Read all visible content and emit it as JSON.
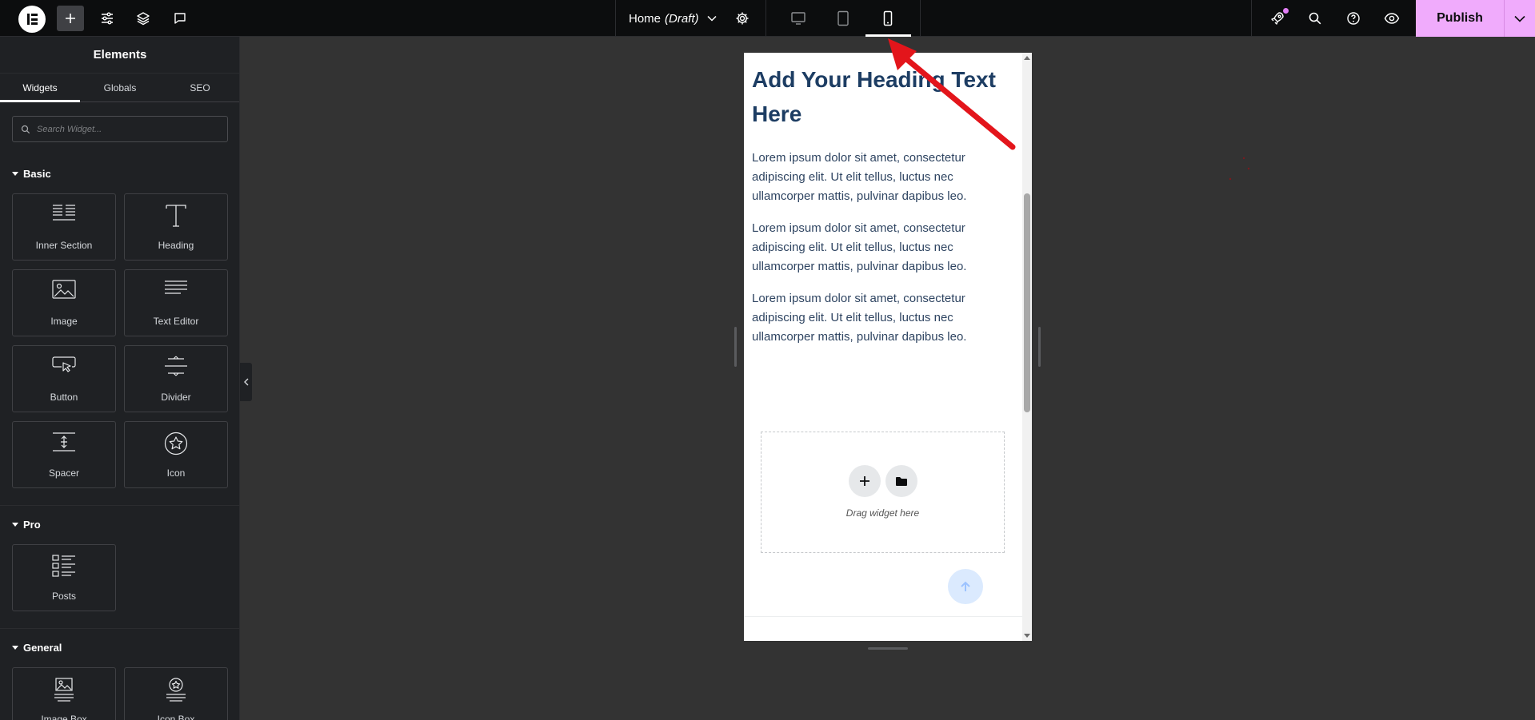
{
  "topbar": {
    "page_name": "Home",
    "page_status": "(Draft)",
    "publish_label": "Publish",
    "accent_color": "#f0abfc"
  },
  "sidebar": {
    "title": "Elements",
    "tabs": [
      {
        "label": "Widgets",
        "active": true
      },
      {
        "label": "Globals",
        "active": false
      },
      {
        "label": "SEO",
        "active": false
      }
    ],
    "search_placeholder": "Search Widget...",
    "categories": [
      {
        "name": "Basic",
        "widgets": [
          {
            "label": "Inner Section",
            "icon": "inner-section-icon"
          },
          {
            "label": "Heading",
            "icon": "heading-icon"
          },
          {
            "label": "Image",
            "icon": "image-icon"
          },
          {
            "label": "Text Editor",
            "icon": "text-editor-icon"
          },
          {
            "label": "Button",
            "icon": "button-icon"
          },
          {
            "label": "Divider",
            "icon": "divider-icon"
          },
          {
            "label": "Spacer",
            "icon": "spacer-icon"
          },
          {
            "label": "Icon",
            "icon": "star-icon"
          }
        ]
      },
      {
        "name": "Pro",
        "widgets": [
          {
            "label": "Posts",
            "icon": "posts-icon"
          }
        ]
      },
      {
        "name": "General",
        "widgets": [
          {
            "label": "Image Box",
            "icon": "image-box-icon"
          },
          {
            "label": "Icon Box",
            "icon": "icon-box-icon"
          }
        ]
      }
    ]
  },
  "canvas": {
    "heading": "Add Your Heading Text Here",
    "paragraphs": [
      "Lorem ipsum dolor sit amet, consectetur adipiscing elit. Ut elit tellus, luctus nec ullamcorper mattis, pulvinar dapibus leo.",
      "Lorem ipsum dolor sit amet, consectetur adipiscing elit. Ut elit tellus, luctus nec ullamcorper mattis, pulvinar dapibus leo.",
      "Lorem ipsum dolor sit amet, consectetur adipiscing elit. Ut elit tellus, luctus nec ullamcorper mattis, pulvinar dapibus leo."
    ],
    "drop_text": "Drag widget here"
  },
  "annotation_color": "#e3151b"
}
